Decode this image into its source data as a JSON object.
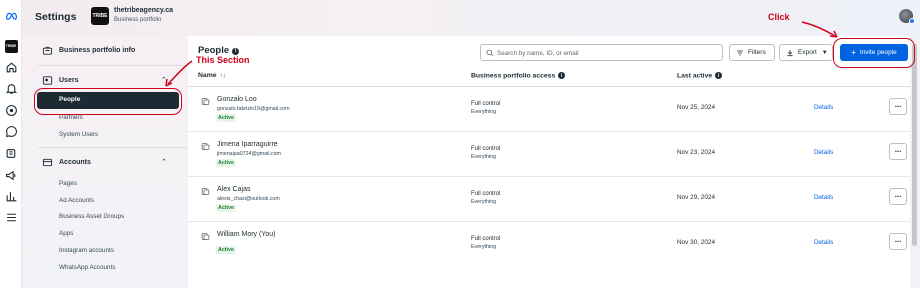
{
  "header": {
    "title": "Settings",
    "business_logo_text": "TRIBE",
    "business_name": "thetribeagency.ca",
    "business_subtitle": "Business portfolio"
  },
  "sidebar": {
    "portfolio_info": "Business portfolio info",
    "users_section": "Users",
    "users_items": [
      "People",
      "Partners",
      "System Users"
    ],
    "accounts_section": "Accounts",
    "accounts_items": [
      "Pages",
      "Ad Accounts",
      "Business Asset Groups",
      "Apps",
      "Instagram accounts",
      "WhatsApp Accounts"
    ]
  },
  "main": {
    "title": "People",
    "search_placeholder": "Search by name, ID, or email",
    "filters_label": "Filters",
    "export_label": "Export",
    "invite_label": "Invite people",
    "columns": {
      "name": "Name",
      "access": "Business portfolio access",
      "last_active": "Last active"
    },
    "details_label": "Details",
    "rows": [
      {
        "name": "Gonzalo Loo",
        "email": "gonzalo.fabrizio19@gmail.com",
        "status": "Active",
        "access": "Full control",
        "access_scope": "Everything",
        "last_active": "Nov 25, 2024"
      },
      {
        "name": "Jimena Iparraguirre",
        "email": "jimenaipa0724@gmail.com",
        "status": "Active",
        "access": "Full control",
        "access_scope": "Everything",
        "last_active": "Nov 23, 2024"
      },
      {
        "name": "Alex Cajas",
        "email": "alexis_chasi@outlook.com",
        "status": "Active",
        "access": "Full control",
        "access_scope": "Everything",
        "last_active": "Nov 29, 2024"
      },
      {
        "name": "William Mory (You)",
        "email": "",
        "status": "Active",
        "access": "Full control",
        "access_scope": "Everything",
        "last_active": "Nov 30, 2024"
      }
    ]
  },
  "annotations": {
    "click": "Click",
    "this_section": "This Section",
    "color": "#d0021b"
  },
  "icons": [
    "meta-logo",
    "tribe-logo",
    "home-icon",
    "bell-icon",
    "compass-icon",
    "chat-icon",
    "pages-icon",
    "megaphone-icon",
    "chart-icon",
    "menu-icon",
    "briefcase-icon",
    "users-icon",
    "accounts-icon",
    "search-icon",
    "filter-icon",
    "download-icon",
    "plus-icon",
    "person-card-icon",
    "more-icon"
  ]
}
